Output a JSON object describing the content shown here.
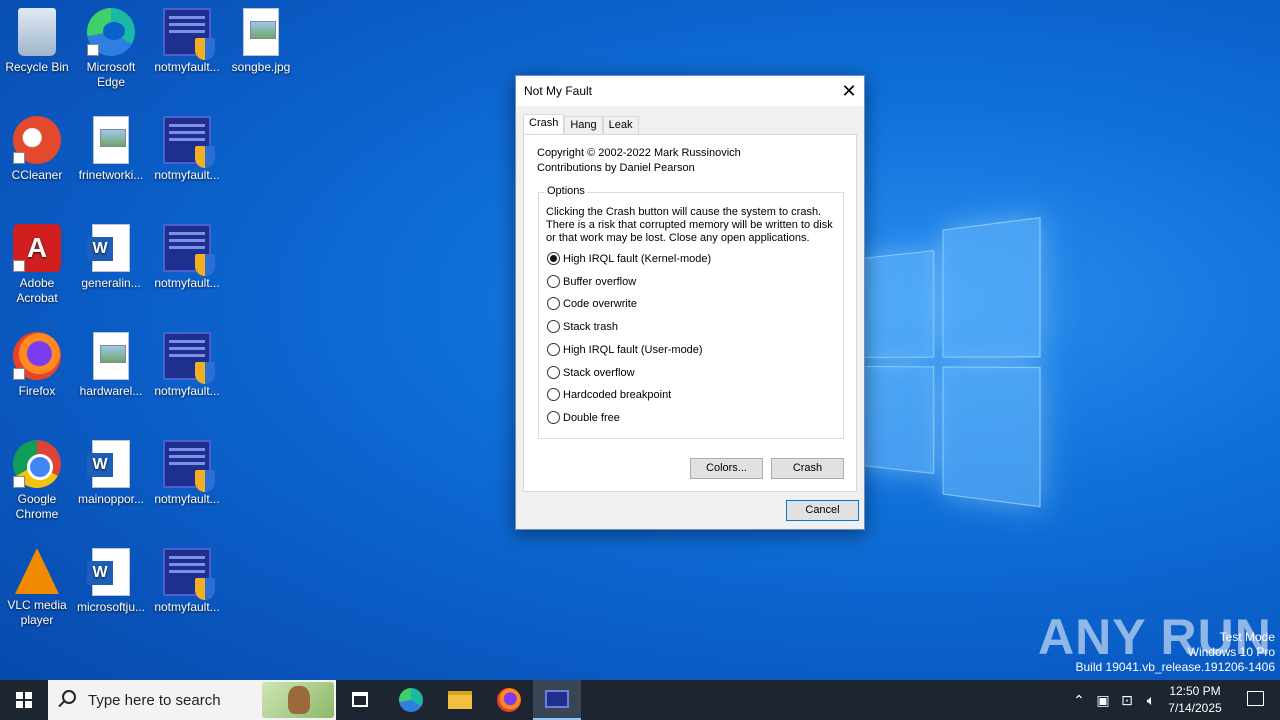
{
  "desktop": {
    "icons": [
      {
        "label": "Recycle Bin",
        "icon": "recycle-bin-icon"
      },
      {
        "label": "Microsoft Edge",
        "icon": "edge-icon"
      },
      {
        "label": "notmyfault...",
        "icon": "notmyfault-icon"
      },
      {
        "label": "songbe.jpg",
        "icon": "image-file-icon"
      },
      {
        "label": "CCleaner",
        "icon": "ccleaner-icon"
      },
      {
        "label": "frinetworki...",
        "icon": "image-file-icon"
      },
      {
        "label": "notmyfault...",
        "icon": "notmyfault-icon"
      },
      {
        "label": "Adobe Acrobat",
        "icon": "acrobat-icon"
      },
      {
        "label": "generalin...",
        "icon": "word-doc-icon"
      },
      {
        "label": "notmyfault...",
        "icon": "notmyfault-icon"
      },
      {
        "label": "Firefox",
        "icon": "firefox-icon"
      },
      {
        "label": "hardwarel...",
        "icon": "image-file-icon"
      },
      {
        "label": "notmyfault...",
        "icon": "notmyfault-icon"
      },
      {
        "label": "Google Chrome",
        "icon": "chrome-icon"
      },
      {
        "label": "mainoppor...",
        "icon": "word-doc-icon"
      },
      {
        "label": "notmyfault...",
        "icon": "notmyfault-icon"
      },
      {
        "label": "VLC media player",
        "icon": "vlc-icon"
      },
      {
        "label": "microsoftju...",
        "icon": "word-doc-icon"
      },
      {
        "label": "notmyfault...",
        "icon": "notmyfault-icon"
      }
    ]
  },
  "dialog": {
    "title": "Not My Fault",
    "tabs": [
      "Crash",
      "Hang",
      "Leak"
    ],
    "active_tab": "Crash",
    "copyright": "Copyright © 2002-2022 Mark Russinovich",
    "contributions": "Contributions by Daniel Pearson",
    "options_legend": "Options",
    "warning": "Clicking the Crash button will cause the system to crash. There is a risk that corrupted memory will be written to disk or that work may be lost. Close any open applications.",
    "options": [
      {
        "label": "High IRQL fault (Kernel-mode)",
        "checked": true
      },
      {
        "label": "Buffer overflow",
        "checked": false
      },
      {
        "label": "Code overwrite",
        "checked": false
      },
      {
        "label": "Stack trash",
        "checked": false
      },
      {
        "label": "High IRQL fault (User-mode)",
        "checked": false
      },
      {
        "label": "Stack overflow",
        "checked": false
      },
      {
        "label": "Hardcoded breakpoint",
        "checked": false
      },
      {
        "label": "Double free",
        "checked": false
      }
    ],
    "colors_button": "Colors...",
    "crash_button": "Crash",
    "cancel_button": "Cancel"
  },
  "watermark": {
    "brand": "ANY RUN",
    "line1": "Test Mode",
    "line2": "Windows 10 Pro",
    "line3": "Build 19041.vb_release.191206-1406"
  },
  "taskbar": {
    "search_placeholder": "Type here to search",
    "time": "12:50 PM",
    "date": "7/14/2025",
    "tray_icons": [
      "chevron-up-icon",
      "meet-now-icon",
      "network-icon",
      "volume-icon"
    ]
  },
  "colors": {
    "accent": "#0078d7",
    "taskbar": "#1c2530",
    "desktop": "#0a5bc4"
  }
}
